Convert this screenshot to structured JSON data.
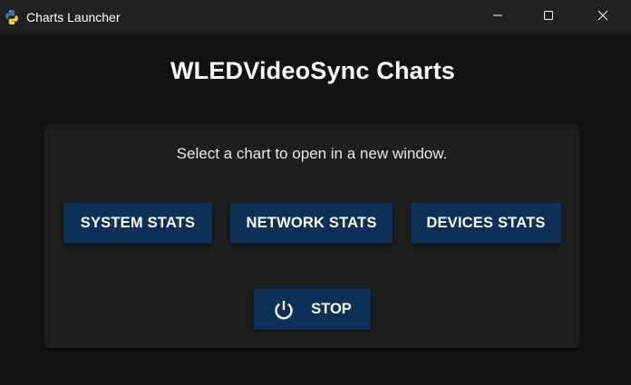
{
  "window": {
    "title": "Charts Launcher",
    "icon": "python-icon",
    "controls": [
      "minimize-icon",
      "maximize-icon",
      "close-icon"
    ]
  },
  "header": {
    "title": "WLEDVideoSync Charts"
  },
  "panel": {
    "instruction": "Select a chart to open in a new window.",
    "buttons": [
      {
        "label": "SYSTEM STATS"
      },
      {
        "label": "NETWORK STATS"
      },
      {
        "label": "DEVICES STATS"
      }
    ],
    "stop": {
      "label": "STOP",
      "icon": "power-icon"
    }
  },
  "colors": {
    "background": "#121212",
    "titlebar": "#202020",
    "card": "#1e1e1e",
    "button": "#0c3057",
    "text": "#ffffff"
  }
}
